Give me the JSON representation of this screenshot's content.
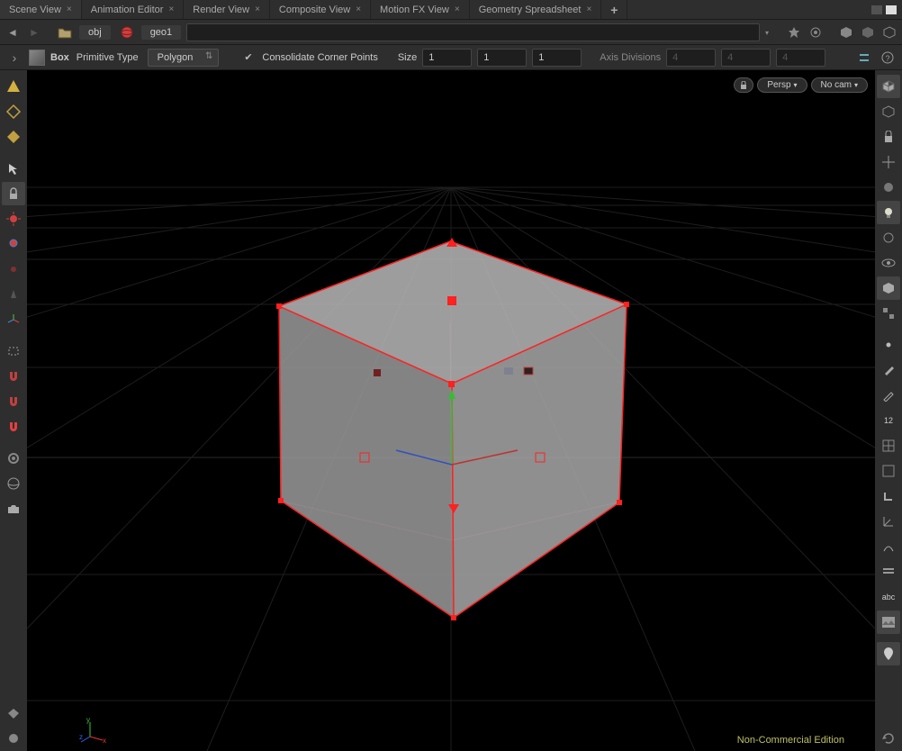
{
  "tabs": {
    "items": [
      {
        "label": "Scene View",
        "active": true
      },
      {
        "label": "Animation Editor"
      },
      {
        "label": "Render View"
      },
      {
        "label": "Composite View"
      },
      {
        "label": "Motion FX View"
      },
      {
        "label": "Geometry Spreadsheet"
      }
    ]
  },
  "nav": {
    "path1": "obj",
    "path2": "geo1"
  },
  "params": {
    "node_label": "Box",
    "type_label": "Primitive Type",
    "primitive_type": "Polygon",
    "consolidate_label": "Consolidate Corner Points",
    "size_label": "Size",
    "size_x": "1",
    "size_y": "1",
    "size_z": "1",
    "axis_label": "Axis Divisions",
    "axis_x": "4",
    "axis_y": "4",
    "axis_z": "4"
  },
  "viewoverlay": {
    "camera": "Persp",
    "display": "No cam"
  },
  "footer": {
    "edition": "Non-Commercial Edition"
  },
  "righttool_label": "abc",
  "righttool_num": "12"
}
